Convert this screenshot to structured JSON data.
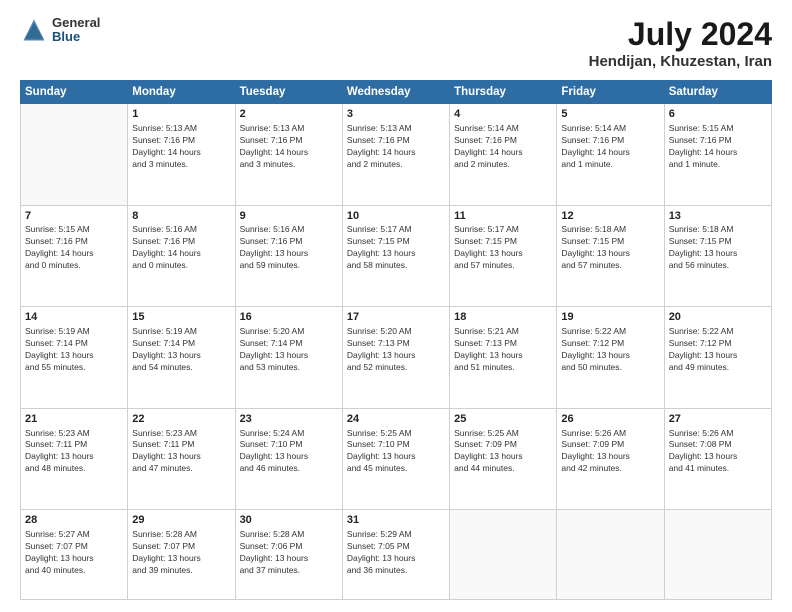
{
  "header": {
    "logo": {
      "general": "General",
      "blue": "Blue"
    },
    "month": "July 2024",
    "location": "Hendijan, Khuzestan, Iran"
  },
  "weekdays": [
    "Sunday",
    "Monday",
    "Tuesday",
    "Wednesday",
    "Thursday",
    "Friday",
    "Saturday"
  ],
  "weeks": [
    [
      {
        "day": "",
        "info": ""
      },
      {
        "day": "1",
        "info": "Sunrise: 5:13 AM\nSunset: 7:16 PM\nDaylight: 14 hours\nand 3 minutes."
      },
      {
        "day": "2",
        "info": "Sunrise: 5:13 AM\nSunset: 7:16 PM\nDaylight: 14 hours\nand 3 minutes."
      },
      {
        "day": "3",
        "info": "Sunrise: 5:13 AM\nSunset: 7:16 PM\nDaylight: 14 hours\nand 2 minutes."
      },
      {
        "day": "4",
        "info": "Sunrise: 5:14 AM\nSunset: 7:16 PM\nDaylight: 14 hours\nand 2 minutes."
      },
      {
        "day": "5",
        "info": "Sunrise: 5:14 AM\nSunset: 7:16 PM\nDaylight: 14 hours\nand 1 minute."
      },
      {
        "day": "6",
        "info": "Sunrise: 5:15 AM\nSunset: 7:16 PM\nDaylight: 14 hours\nand 1 minute."
      }
    ],
    [
      {
        "day": "7",
        "info": "Sunrise: 5:15 AM\nSunset: 7:16 PM\nDaylight: 14 hours\nand 0 minutes."
      },
      {
        "day": "8",
        "info": "Sunrise: 5:16 AM\nSunset: 7:16 PM\nDaylight: 14 hours\nand 0 minutes."
      },
      {
        "day": "9",
        "info": "Sunrise: 5:16 AM\nSunset: 7:16 PM\nDaylight: 13 hours\nand 59 minutes."
      },
      {
        "day": "10",
        "info": "Sunrise: 5:17 AM\nSunset: 7:15 PM\nDaylight: 13 hours\nand 58 minutes."
      },
      {
        "day": "11",
        "info": "Sunrise: 5:17 AM\nSunset: 7:15 PM\nDaylight: 13 hours\nand 57 minutes."
      },
      {
        "day": "12",
        "info": "Sunrise: 5:18 AM\nSunset: 7:15 PM\nDaylight: 13 hours\nand 57 minutes."
      },
      {
        "day": "13",
        "info": "Sunrise: 5:18 AM\nSunset: 7:15 PM\nDaylight: 13 hours\nand 56 minutes."
      }
    ],
    [
      {
        "day": "14",
        "info": "Sunrise: 5:19 AM\nSunset: 7:14 PM\nDaylight: 13 hours\nand 55 minutes."
      },
      {
        "day": "15",
        "info": "Sunrise: 5:19 AM\nSunset: 7:14 PM\nDaylight: 13 hours\nand 54 minutes."
      },
      {
        "day": "16",
        "info": "Sunrise: 5:20 AM\nSunset: 7:14 PM\nDaylight: 13 hours\nand 53 minutes."
      },
      {
        "day": "17",
        "info": "Sunrise: 5:20 AM\nSunset: 7:13 PM\nDaylight: 13 hours\nand 52 minutes."
      },
      {
        "day": "18",
        "info": "Sunrise: 5:21 AM\nSunset: 7:13 PM\nDaylight: 13 hours\nand 51 minutes."
      },
      {
        "day": "19",
        "info": "Sunrise: 5:22 AM\nSunset: 7:12 PM\nDaylight: 13 hours\nand 50 minutes."
      },
      {
        "day": "20",
        "info": "Sunrise: 5:22 AM\nSunset: 7:12 PM\nDaylight: 13 hours\nand 49 minutes."
      }
    ],
    [
      {
        "day": "21",
        "info": "Sunrise: 5:23 AM\nSunset: 7:11 PM\nDaylight: 13 hours\nand 48 minutes."
      },
      {
        "day": "22",
        "info": "Sunrise: 5:23 AM\nSunset: 7:11 PM\nDaylight: 13 hours\nand 47 minutes."
      },
      {
        "day": "23",
        "info": "Sunrise: 5:24 AM\nSunset: 7:10 PM\nDaylight: 13 hours\nand 46 minutes."
      },
      {
        "day": "24",
        "info": "Sunrise: 5:25 AM\nSunset: 7:10 PM\nDaylight: 13 hours\nand 45 minutes."
      },
      {
        "day": "25",
        "info": "Sunrise: 5:25 AM\nSunset: 7:09 PM\nDaylight: 13 hours\nand 44 minutes."
      },
      {
        "day": "26",
        "info": "Sunrise: 5:26 AM\nSunset: 7:09 PM\nDaylight: 13 hours\nand 42 minutes."
      },
      {
        "day": "27",
        "info": "Sunrise: 5:26 AM\nSunset: 7:08 PM\nDaylight: 13 hours\nand 41 minutes."
      }
    ],
    [
      {
        "day": "28",
        "info": "Sunrise: 5:27 AM\nSunset: 7:07 PM\nDaylight: 13 hours\nand 40 minutes."
      },
      {
        "day": "29",
        "info": "Sunrise: 5:28 AM\nSunset: 7:07 PM\nDaylight: 13 hours\nand 39 minutes."
      },
      {
        "day": "30",
        "info": "Sunrise: 5:28 AM\nSunset: 7:06 PM\nDaylight: 13 hours\nand 37 minutes."
      },
      {
        "day": "31",
        "info": "Sunrise: 5:29 AM\nSunset: 7:05 PM\nDaylight: 13 hours\nand 36 minutes."
      },
      {
        "day": "",
        "info": ""
      },
      {
        "day": "",
        "info": ""
      },
      {
        "day": "",
        "info": ""
      }
    ]
  ]
}
